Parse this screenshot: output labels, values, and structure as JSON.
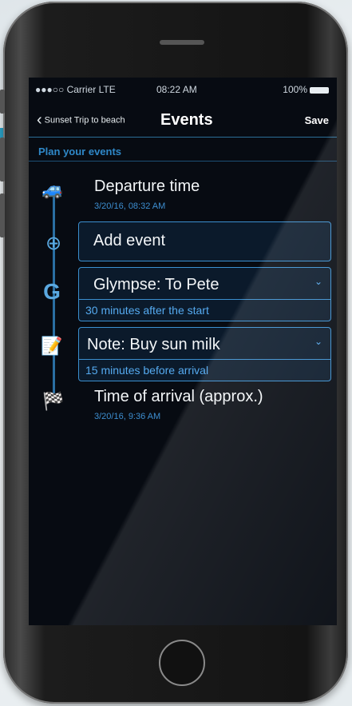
{
  "status_bar": {
    "carrier": "●●●○○ Carrier LTE",
    "time": "08:22 AM",
    "battery": "100%"
  },
  "nav": {
    "back_label": "Sunset Trip to beach",
    "title": "Events",
    "save_label": "Save"
  },
  "section_title": "Plan your events",
  "events": [
    {
      "icon": "car-icon",
      "title": "Departure time",
      "subtitle": "3/20/16, 08:32 AM"
    },
    {
      "icon": "plus-icon",
      "title": "Add event"
    },
    {
      "icon": "glympse-icon",
      "title": "Glympse: To Pete",
      "detail": "30 minutes after the start"
    },
    {
      "icon": "note-icon",
      "title": "Note: Buy sun milk",
      "detail": "15 minutes before arrival"
    },
    {
      "icon": "checkered-flag-icon",
      "title": "Time of arrival (approx.)",
      "subtitle": "3/20/16,   9:36 AM"
    }
  ],
  "colors": {
    "accent": "#3b8fcf",
    "background": "#070b12",
    "section": "#2f88c8"
  }
}
